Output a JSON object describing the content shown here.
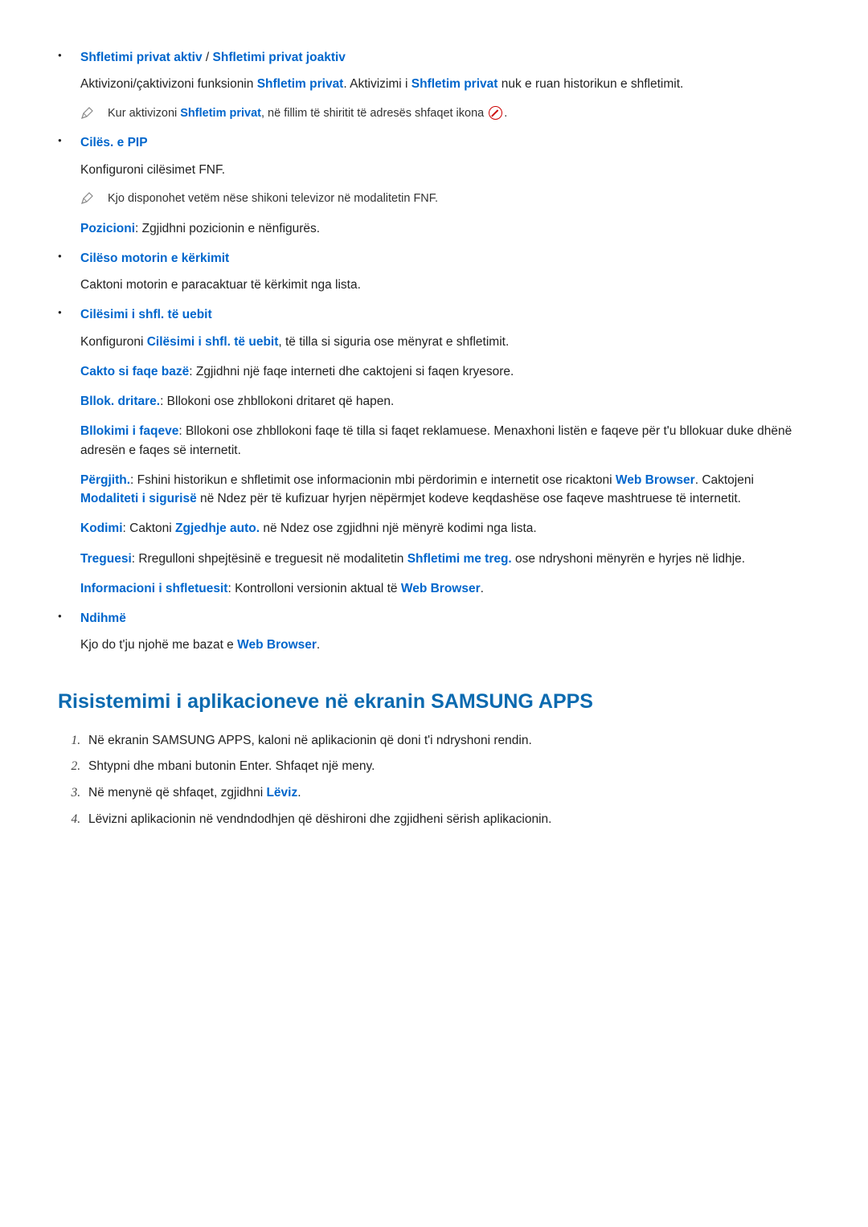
{
  "items": {
    "private": {
      "title_a": "Shfletimi privat aktiv",
      "sep": " / ",
      "title_b": "Shfletimi privat joaktiv",
      "desc_a": "Aktivizoni/çaktivizoni funksionin ",
      "term1": "Shfletim privat",
      "desc_b": ". Aktivizimi i ",
      "term2": "Shfletim privat",
      "desc_c": " nuk e ruan historikun e shfletimit.",
      "note_a": "Kur aktivizoni ",
      "note_term": "Shfletim privat",
      "note_b": ", në fillim të shiritit të adresës shfaqet ikona ",
      "note_c": "."
    },
    "pip": {
      "title": "Cilës. e PIP",
      "desc": "Konfiguroni cilësimet FNF.",
      "note": "Kjo disponohet vetëm nëse shikoni televizor në modalitetin FNF.",
      "pos_label": "Pozicioni",
      "pos_text": ": Zgjidhni pozicionin e nënfigurës."
    },
    "search": {
      "title": "Cilëso motorin e kërkimit",
      "desc": "Caktoni motorin e paracaktuar të kërkimit nga lista."
    },
    "websettings": {
      "title": "Cilësimi i shfl. të uebit",
      "lead_a": "Konfiguroni ",
      "lead_term": "Cilësimi i shfl. të uebit",
      "lead_b": ", të tilla si siguria ose mënyrat e shfletimit.",
      "home_label": "Cakto si faqe bazë",
      "home_text": ": Zgjidhni një faqe interneti dhe caktojeni si faqen kryesore.",
      "popup_label": "Bllok. dritare.",
      "popup_text": ": Bllokoni ose zhbllokoni dritaret që hapen.",
      "pageblock_label": "Bllokimi i faqeve",
      "pageblock_text": ": Bllokoni ose zhbllokoni faqe të tilla si faqet reklamuese. Menaxhoni listën e faqeve për t'u bllokuar duke dhënë adresën e faqes së internetit.",
      "general_label": "Përgjith.",
      "general_a": ": Fshini historikun e shfletimit ose informacionin mbi përdorimin e internetit ose ricaktoni ",
      "general_wb": "Web Browser",
      "general_b": ". Caktojeni ",
      "general_mode": "Modaliteti i sigurisë",
      "general_c": " në Ndez  për të kufizuar hyrjen nëpërmjet kodeve keqdashëse ose faqeve mashtruese të internetit.",
      "encoding_label": "Kodimi",
      "encoding_a": ": Caktoni ",
      "encoding_term": "Zgjedhje auto.",
      "encoding_b": " në Ndez  ose zgjidhni një mënyrë kodimi nga lista.",
      "cursor_label": "Treguesi",
      "cursor_a": ": Rregulloni shpejtësinë e treguesit në modalitetin ",
      "cursor_term": "Shfletimi me treg.",
      "cursor_b": " ose ndryshoni mënyrën e hyrjes në lidhje.",
      "info_label": "Informacioni i shfletuesit",
      "info_a": ": Kontrolloni versionin aktual të ",
      "info_wb": "Web Browser",
      "info_b": "."
    },
    "help": {
      "title": "Ndihmë",
      "desc_a": "Kjo do t'ju njohë me bazat e ",
      "desc_wb": "Web Browser",
      "desc_b": "."
    }
  },
  "heading2": "Risistemimi i aplikacioneve në ekranin SAMSUNG APPS",
  "steps": {
    "s1": "Në ekranin SAMSUNG APPS, kaloni në aplikacionin që doni t'i ndryshoni rendin.",
    "s2": "Shtypni dhe mbani butonin Enter. Shfaqet një meny.",
    "s3_a": "Në menynë që shfaqet, zgjidhni ",
    "s3_term": "Lëviz",
    "s3_b": ".",
    "s4": "Lëvizni aplikacionin në vendndodhjen që dëshironi dhe zgjidheni sërish aplikacionin."
  }
}
